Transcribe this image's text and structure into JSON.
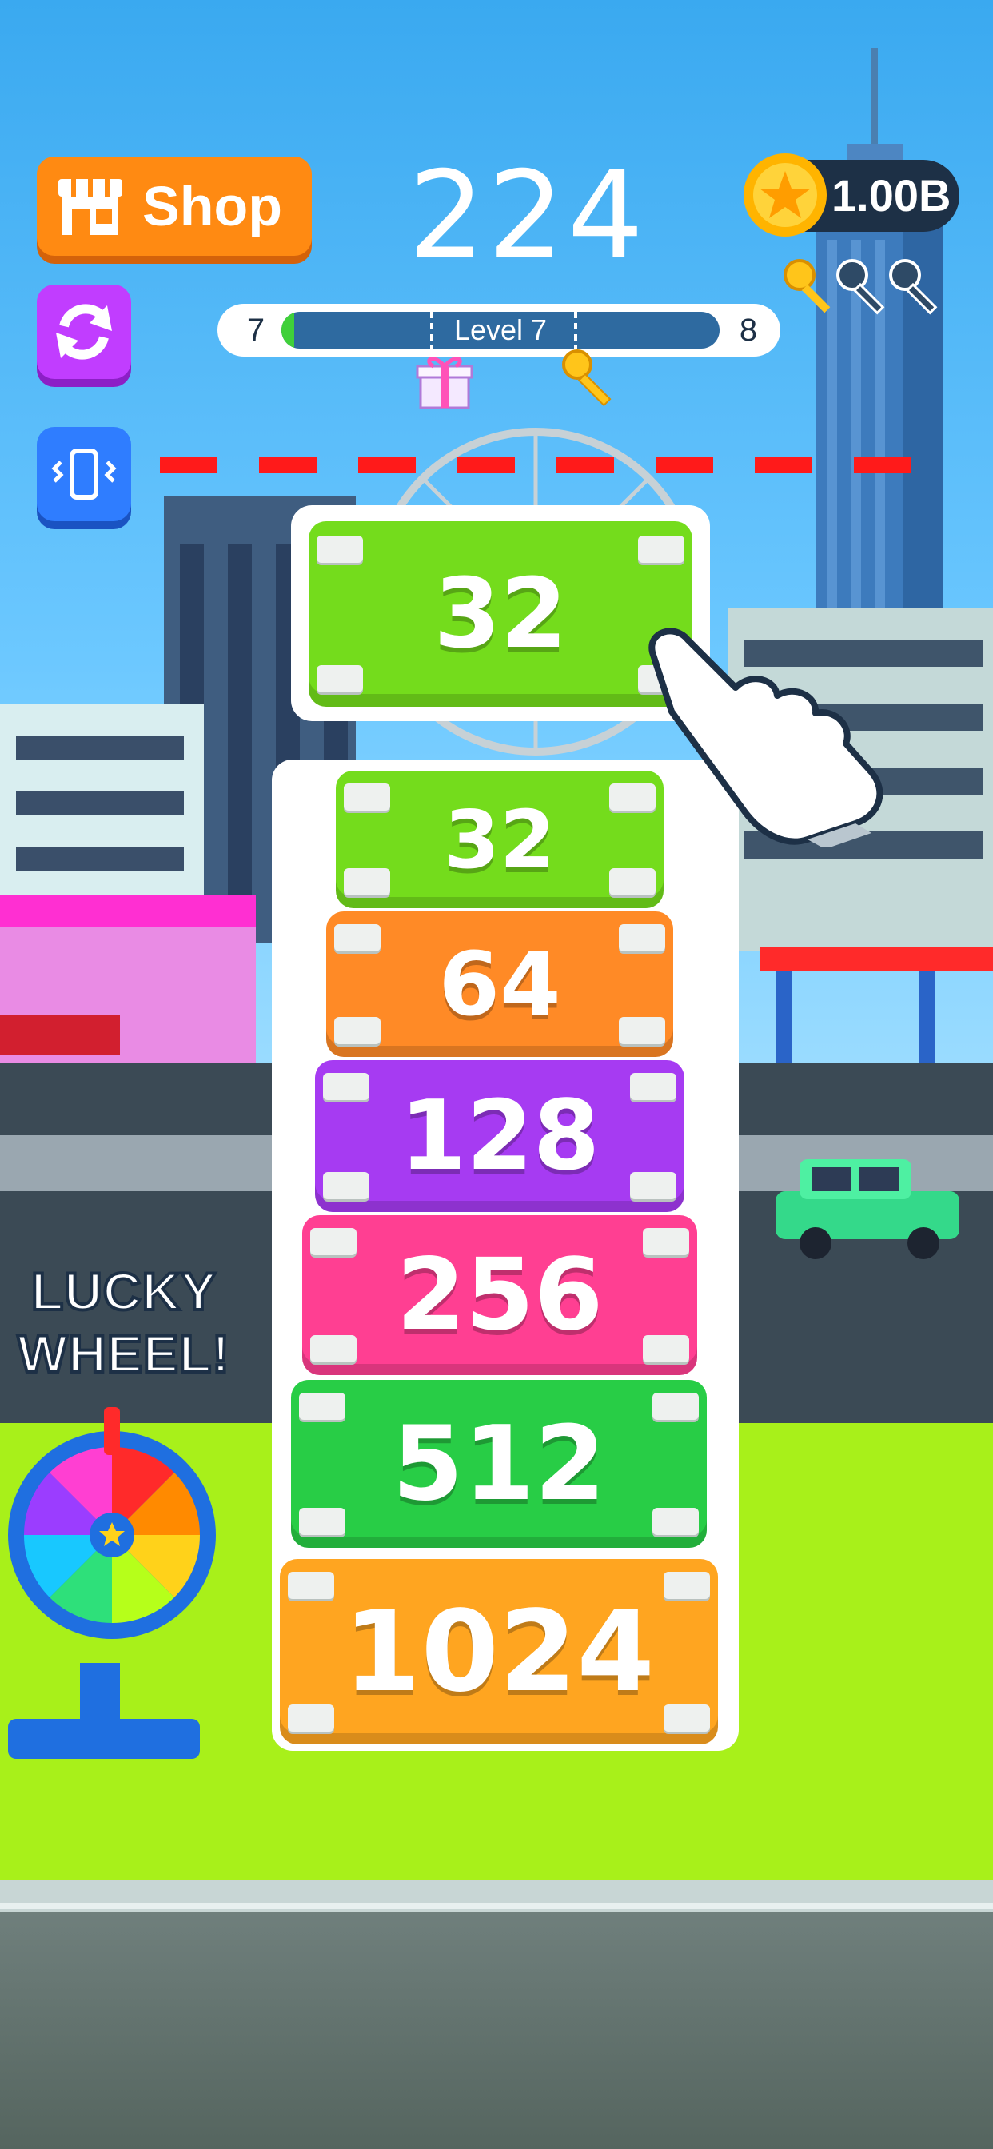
{
  "hud": {
    "shop_label": "Shop",
    "score": "224",
    "coins": "1.00B",
    "level_current": "7",
    "level_label": "Level 7",
    "level_next": "8",
    "level_progress": 0.03,
    "keys_collected": 1,
    "keys_total": 3
  },
  "icons": {
    "shop": "shop-icon",
    "restart": "restart-icon",
    "vibration": "vibration-icon",
    "coin": "coin-icon",
    "key": "key-icon",
    "gift": "gift-icon",
    "hand": "hand-pointer-icon",
    "wheel": "lucky-wheel-icon"
  },
  "colors": {
    "shop": "#ff8a12",
    "restart": "#c13dff",
    "vibration": "#2f7dff",
    "limit_line": "#ff1a1a"
  },
  "current_block": {
    "value": "32",
    "color": "#74dc1c"
  },
  "stack": [
    {
      "value": "32",
      "color": "#74dc1c"
    },
    {
      "value": "64",
      "color": "#ff8a26"
    },
    {
      "value": "128",
      "color": "#a63bf2"
    },
    {
      "value": "256",
      "color": "#ff3f92"
    },
    {
      "value": "512",
      "color": "#28cd46"
    },
    {
      "value": "1024",
      "color": "#ffa520"
    }
  ],
  "lucky_wheel": {
    "label_line1": "LUCKY",
    "label_line2": "WHEEL!"
  }
}
